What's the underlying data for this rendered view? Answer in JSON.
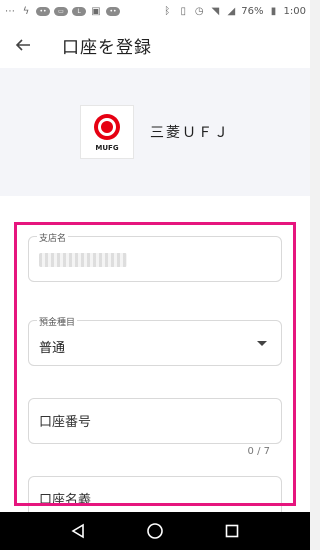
{
  "status_bar": {
    "battery": "76%",
    "time": "1:00"
  },
  "header": {
    "title": "口座を登録"
  },
  "bank": {
    "name": "三菱ＵＦＪ",
    "logo_text": "MUFG",
    "logo_color": "#e60012"
  },
  "form": {
    "branch": {
      "label": "支店名"
    },
    "deposit_type": {
      "label": "預金種目",
      "value": "普通"
    },
    "account_number": {
      "placeholder": "口座番号",
      "counter": "0 / 7"
    },
    "account_name": {
      "placeholder": "口座名義"
    }
  },
  "colors": {
    "highlight": "#e6157e"
  }
}
